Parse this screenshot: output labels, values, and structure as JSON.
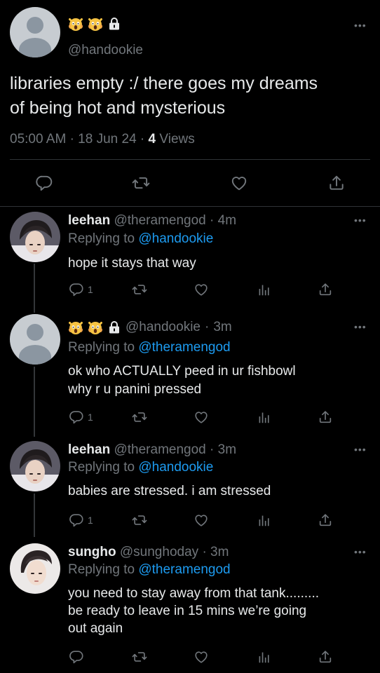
{
  "main_tweet": {
    "handle": "@handookie",
    "text_line1": "libraries empty :/ there goes my dreams",
    "text_line2": "of being hot and mysterious",
    "time": "05:00 AM",
    "sep1": "·",
    "date": "18 Jun 24",
    "sep2": "·",
    "views_count": "4",
    "views_label": "Views",
    "more": "•••"
  },
  "replies": [
    {
      "name": "leehan",
      "handle": "@theramengod",
      "sep": "·",
      "age": "4m",
      "replying_label": "Replying to",
      "replying_to": "@handookie",
      "line1": "hope it stays that way",
      "reply_count": "1",
      "more": "•••"
    },
    {
      "name": "",
      "handle": "@handookie",
      "sep": "·",
      "age": "3m",
      "replying_label": "Replying to",
      "replying_to": "@theramengod",
      "line1": "ok who ACTUALLY peed in ur fishbowl",
      "line2": "why r u panini pressed",
      "reply_count": "1",
      "more": "•••"
    },
    {
      "name": "leehan",
      "handle": "@theramengod",
      "sep": "·",
      "age": "3m",
      "replying_label": "Replying to",
      "replying_to": "@handookie",
      "line1": "babies are stressed. i am stressed",
      "reply_count": "1",
      "more": "•••"
    },
    {
      "name": "sungho",
      "handle": "@sunghoday",
      "sep": "·",
      "age": "3m",
      "replying_label": "Replying to",
      "replying_to": "@theramengod",
      "line1": "you need to stay away from that tank.........",
      "line2": "be ready to leave in 15 mins we’re going",
      "line3": "out again",
      "more": "•••"
    }
  ],
  "colors": {
    "background": "#000000",
    "text": "#e7e9ea",
    "secondary": "#71767b",
    "link": "#1d9bf0",
    "divider": "#2f3336"
  },
  "icons": [
    "reply-icon",
    "retweet-icon",
    "like-icon",
    "share-icon",
    "views-icon",
    "lock-icon",
    "scream-emoji-icon"
  ]
}
